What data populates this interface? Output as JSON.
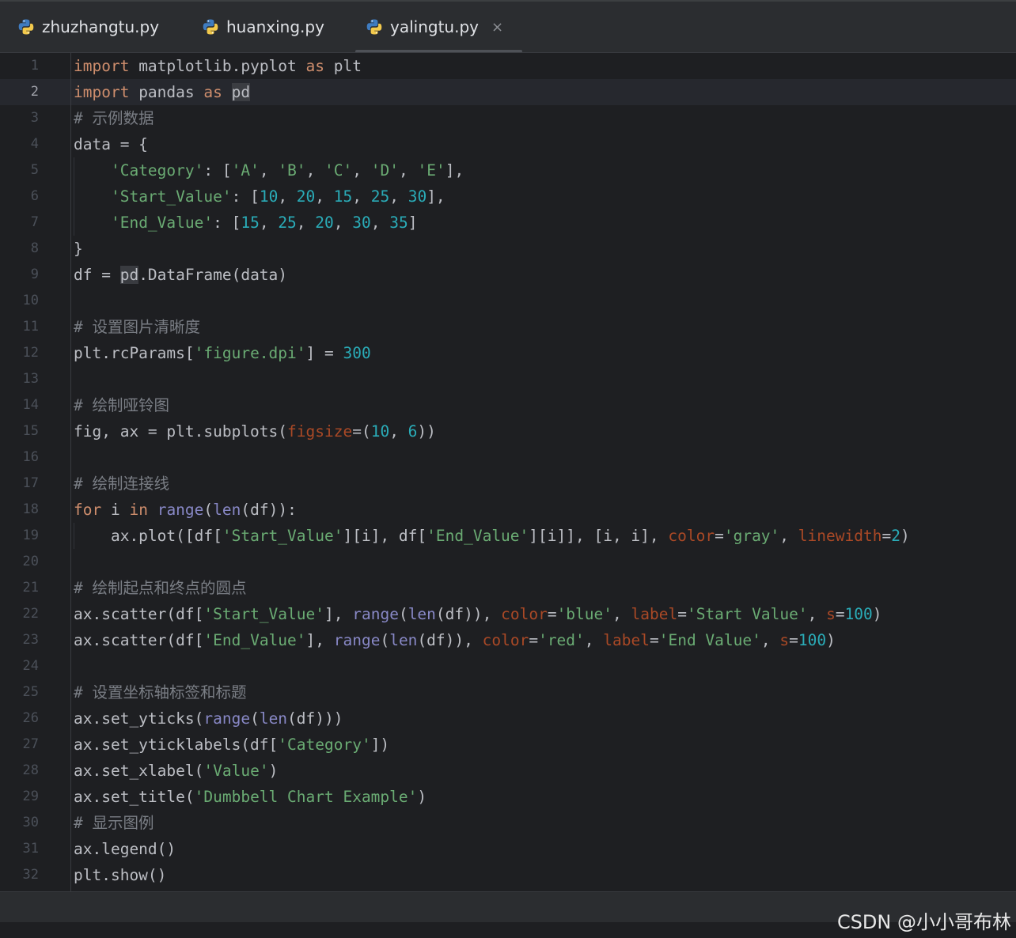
{
  "tabs": [
    {
      "label": "zhuzhangtu.py",
      "active": false
    },
    {
      "label": "huanxing.py",
      "active": false
    },
    {
      "label": "yalingtu.py",
      "active": true,
      "close": "×"
    }
  ],
  "editor": {
    "current_line": 2,
    "lines": [
      {
        "n": "1",
        "html": "<span class=\"k\">import</span> matplotlib.pyplot <span class=\"k\">as</span> plt"
      },
      {
        "n": "2",
        "html": "<span class=\"k\">import</span> pandas <span class=\"k\">as</span> <span class=\"hl\">pd</span>"
      },
      {
        "n": "3",
        "html": "<span class=\"c\"># 示例数据</span>"
      },
      {
        "n": "4",
        "html": "data = {"
      },
      {
        "n": "5",
        "html": "    <span class=\"s\">'Category'</span>: [<span class=\"s\">'A'</span>, <span class=\"s\">'B'</span>, <span class=\"s\">'C'</span>, <span class=\"s\">'D'</span>, <span class=\"s\">'E'</span>],"
      },
      {
        "n": "6",
        "html": "    <span class=\"s\">'Start_Value'</span>: [<span class=\"n\">10</span>, <span class=\"n\">20</span>, <span class=\"n\">15</span>, <span class=\"n\">25</span>, <span class=\"n\">30</span>],"
      },
      {
        "n": "7",
        "html": "    <span class=\"s\">'End_Value'</span>: [<span class=\"n\">15</span>, <span class=\"n\">25</span>, <span class=\"n\">20</span>, <span class=\"n\">30</span>, <span class=\"n\">35</span>]"
      },
      {
        "n": "8",
        "html": "}"
      },
      {
        "n": "9",
        "html": "df = <span class=\"hl2\">pd</span>.DataFrame(data)"
      },
      {
        "n": "10",
        "html": ""
      },
      {
        "n": "11",
        "html": "<span class=\"c\"># 设置图片清晰度</span>"
      },
      {
        "n": "12",
        "html": "plt.rcParams[<span class=\"s\">'figure.dpi'</span>] = <span class=\"n\">300</span>"
      },
      {
        "n": "13",
        "html": ""
      },
      {
        "n": "14",
        "html": "<span class=\"c\"># 绘制哑铃图</span>"
      },
      {
        "n": "15",
        "html": "fig, ax = plt.subplots(<span class=\"p\">figsize</span>=(<span class=\"n\">10</span>, <span class=\"n\">6</span>))"
      },
      {
        "n": "16",
        "html": ""
      },
      {
        "n": "17",
        "html": "<span class=\"c\"># 绘制连接线</span>"
      },
      {
        "n": "18",
        "html": "<span class=\"k\">for</span> i <span class=\"k\">in</span> <span class=\"b\">range</span>(<span class=\"b\">len</span>(df)):"
      },
      {
        "n": "19",
        "html": "    ax.plot([df[<span class=\"s\">'Start_Value'</span>][i], df[<span class=\"s\">'End_Value'</span>][i]], [i, i], <span class=\"p\">color</span>=<span class=\"s\">'gray'</span>, <span class=\"p\">linewidth</span>=<span class=\"n\">2</span>)"
      },
      {
        "n": "20",
        "html": ""
      },
      {
        "n": "21",
        "html": "<span class=\"c\"># 绘制起点和终点的圆点</span>"
      },
      {
        "n": "22",
        "html": "ax.scatter(df[<span class=\"s\">'Start_Value'</span>], <span class=\"b\">range</span>(<span class=\"b\">len</span>(df)), <span class=\"p\">color</span>=<span class=\"s\">'blue'</span>, <span class=\"p\">label</span>=<span class=\"s\">'Start Value'</span>, <span class=\"p\">s</span>=<span class=\"n\">100</span>)"
      },
      {
        "n": "23",
        "html": "ax.scatter(df[<span class=\"s\">'End_Value'</span>], <span class=\"b\">range</span>(<span class=\"b\">len</span>(df)), <span class=\"p\">color</span>=<span class=\"s\">'red'</span>, <span class=\"p\">label</span>=<span class=\"s\">'End Value'</span>, <span class=\"p\">s</span>=<span class=\"n\">100</span>)"
      },
      {
        "n": "24",
        "html": ""
      },
      {
        "n": "25",
        "html": "<span class=\"c\"># 设置坐标轴标签和标题</span>"
      },
      {
        "n": "26",
        "html": "ax.set_yticks(<span class=\"b\">range</span>(<span class=\"b\">len</span>(df)))"
      },
      {
        "n": "27",
        "html": "ax.set_yticklabels(df[<span class=\"s\">'Category'</span>])"
      },
      {
        "n": "28",
        "html": "ax.set_xlabel(<span class=\"s\">'Value'</span>)"
      },
      {
        "n": "29",
        "html": "ax.set_title(<span class=\"s\">'Dumbbell Chart Example'</span>)"
      },
      {
        "n": "30",
        "html": "<span class=\"c\"># 显示图例</span>"
      },
      {
        "n": "31",
        "html": "ax.legend()"
      },
      {
        "n": "32",
        "html": "plt.show()"
      }
    ]
  },
  "watermark": "CSDN @小小哥布林",
  "colors": {
    "keyword": "#cf8e6d",
    "string": "#6aab73",
    "number": "#2aacb8",
    "builtin": "#8888c6",
    "param": "#aa4926",
    "comment": "#7a7e85",
    "text": "#bcbec4",
    "background": "#1e1f22"
  }
}
